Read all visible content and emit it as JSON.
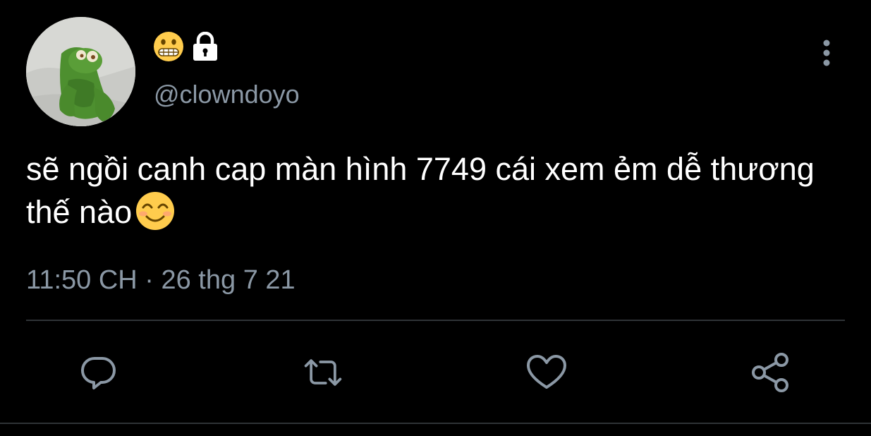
{
  "tweet": {
    "handle": "@clowndoyo",
    "name_emoji": "grimacing-face-emoji",
    "protected_icon": "lock-icon",
    "text": "sẽ ngồi canh cap màn hình 7749 cái xem ẻm dễ thương thế nào",
    "text_emoji": "smiling-face-with-smiling-eyes-emoji",
    "timestamp": "11:50 CH · 26 thg 7 21"
  },
  "actions": [
    {
      "icon": "reply-icon"
    },
    {
      "icon": "retweet-icon"
    },
    {
      "icon": "like-icon"
    },
    {
      "icon": "share-icon"
    }
  ],
  "colors": {
    "background": "#000000",
    "text": "#ffffff",
    "secondary_text": "#8b98a5",
    "divider": "#2f3336",
    "icon": "#8b98a5"
  }
}
